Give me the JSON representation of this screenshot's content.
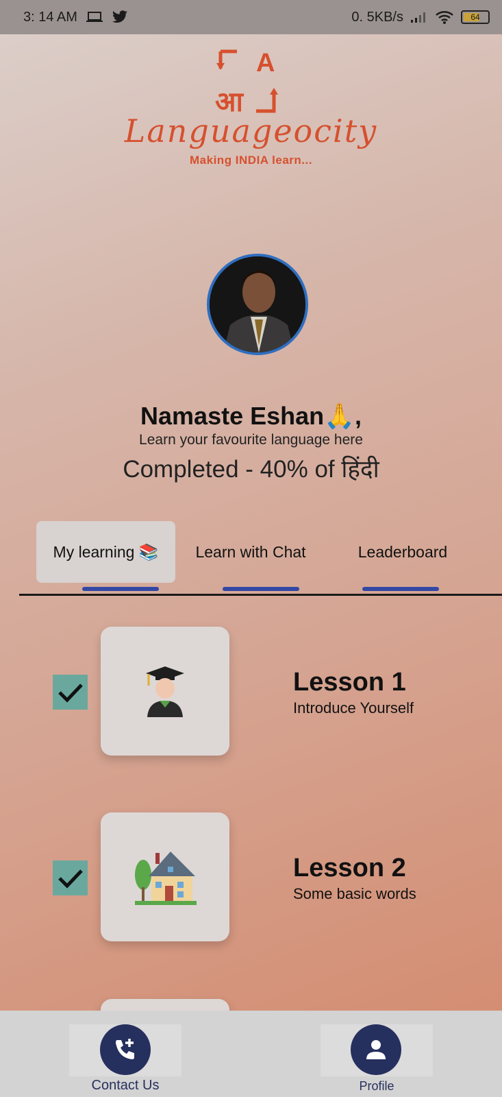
{
  "status_bar": {
    "time": "3: 14 AM",
    "network_speed": "0. 5KB/s",
    "battery": "64"
  },
  "logo": {
    "mark_top": "A",
    "mark_bottom": "आ",
    "wordmark": "Languageocity",
    "tagline": "Making INDIA learn..."
  },
  "profile": {
    "greeting": "Namaste  Eshan🙏,",
    "subtitle": "Learn your favourite language here",
    "progress_text": "Completed - 40% of हिंदी"
  },
  "tabs": [
    {
      "label": "My learning 📚",
      "active": true
    },
    {
      "label": "Learn with Chat",
      "active": false
    },
    {
      "label": "Leaderboard",
      "active": false
    }
  ],
  "lessons": [
    {
      "title": "Lesson 1",
      "subtitle": "Introduce Yourself",
      "completed": true,
      "icon": "graduate-icon"
    },
    {
      "title": "Lesson 2",
      "subtitle": "Some basic words",
      "completed": true,
      "icon": "house-icon"
    }
  ],
  "bottom_nav": {
    "contact_label": "Contact Us",
    "profile_label": "Profile"
  },
  "colors": {
    "accent": "#d6502e",
    "tab_indicator": "#3347a4",
    "checkbox": "#6aa89e",
    "nav_icon_bg": "#26305e"
  }
}
